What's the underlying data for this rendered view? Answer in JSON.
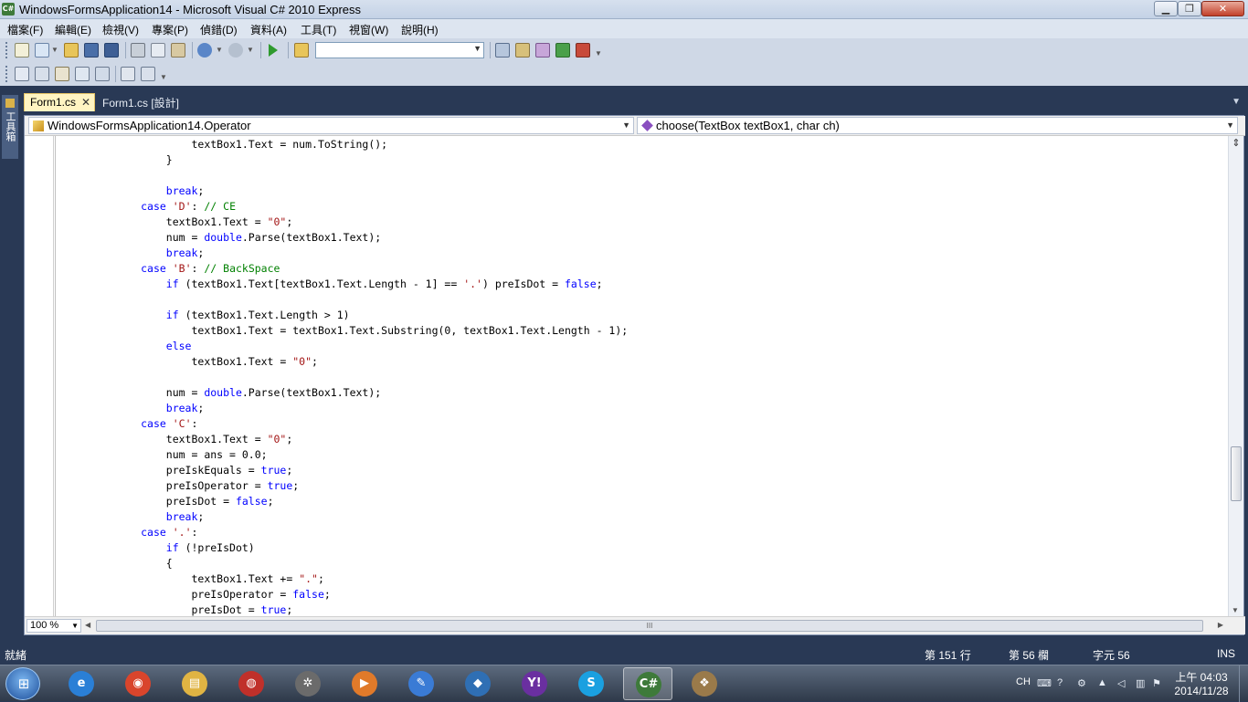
{
  "window": {
    "title": "WindowsFormsApplication14 - Microsoft Visual C# 2010 Express",
    "icon_label": "C#",
    "minimize_glyph": "▁",
    "maximize_glyph": "❐",
    "close_glyph": "✕"
  },
  "menu": [
    "檔案(F)",
    "編輯(E)",
    "檢視(V)",
    "專案(P)",
    "偵錯(D)",
    "資料(A)",
    "工具(T)",
    "視窗(W)",
    "說明(H)"
  ],
  "toolbar": {
    "solution_config_value": ""
  },
  "sidebar": {
    "toolbox_label": "工具箱"
  },
  "tabs": [
    {
      "label": "Form1.cs",
      "active": true,
      "close": "✕"
    },
    {
      "label": "Form1.cs [設計]",
      "active": false
    }
  ],
  "navbar": {
    "class_combo": "WindowsFormsApplication14.Operator",
    "member_combo": "choose(TextBox textBox1, char ch)"
  },
  "code": [
    [
      {
        "t": "                    textBox1.Text = num.ToString();"
      }
    ],
    [
      {
        "t": "                }"
      }
    ],
    [
      {
        "t": ""
      }
    ],
    [
      {
        "t": "                "
      },
      {
        "t": "break",
        "c": "kw"
      },
      {
        "t": ";"
      }
    ],
    [
      {
        "t": "            "
      },
      {
        "t": "case",
        "c": "kw"
      },
      {
        "t": " "
      },
      {
        "t": "'D'",
        "c": "str"
      },
      {
        "t": ": "
      },
      {
        "t": "// CE",
        "c": "cm"
      }
    ],
    [
      {
        "t": "                textBox1.Text = "
      },
      {
        "t": "\"0\"",
        "c": "str"
      },
      {
        "t": ";"
      }
    ],
    [
      {
        "t": "                num = "
      },
      {
        "t": "double",
        "c": "kw"
      },
      {
        "t": ".Parse(textBox1.Text);"
      }
    ],
    [
      {
        "t": "                "
      },
      {
        "t": "break",
        "c": "kw"
      },
      {
        "t": ";"
      }
    ],
    [
      {
        "t": "            "
      },
      {
        "t": "case",
        "c": "kw"
      },
      {
        "t": " "
      },
      {
        "t": "'B'",
        "c": "str"
      },
      {
        "t": ": "
      },
      {
        "t": "// BackSpace",
        "c": "cm"
      }
    ],
    [
      {
        "t": "                "
      },
      {
        "t": "if",
        "c": "kw"
      },
      {
        "t": " (textBox1.Text[textBox1.Text.Length - 1] == "
      },
      {
        "t": "'.'",
        "c": "str"
      },
      {
        "t": ") preIsDot = "
      },
      {
        "t": "false",
        "c": "kw"
      },
      {
        "t": ";"
      }
    ],
    [
      {
        "t": ""
      }
    ],
    [
      {
        "t": "                "
      },
      {
        "t": "if",
        "c": "kw"
      },
      {
        "t": " (textBox1.Text.Length > 1)"
      }
    ],
    [
      {
        "t": "                    textBox1.Text = textBox1.Text.Substring(0, textBox1.Text.Length - 1);"
      }
    ],
    [
      {
        "t": "                "
      },
      {
        "t": "else",
        "c": "kw"
      }
    ],
    [
      {
        "t": "                    textBox1.Text = "
      },
      {
        "t": "\"0\"",
        "c": "str"
      },
      {
        "t": ";"
      }
    ],
    [
      {
        "t": ""
      }
    ],
    [
      {
        "t": "                num = "
      },
      {
        "t": "double",
        "c": "kw"
      },
      {
        "t": ".Parse(textBox1.Text);"
      }
    ],
    [
      {
        "t": "                "
      },
      {
        "t": "break",
        "c": "kw"
      },
      {
        "t": ";"
      }
    ],
    [
      {
        "t": "            "
      },
      {
        "t": "case",
        "c": "kw"
      },
      {
        "t": " "
      },
      {
        "t": "'C'",
        "c": "str"
      },
      {
        "t": ":"
      }
    ],
    [
      {
        "t": "                textBox1.Text = "
      },
      {
        "t": "\"0\"",
        "c": "str"
      },
      {
        "t": ";"
      }
    ],
    [
      {
        "t": "                num = ans = 0.0;"
      }
    ],
    [
      {
        "t": "                preIskEquals = "
      },
      {
        "t": "true",
        "c": "kw"
      },
      {
        "t": ";"
      }
    ],
    [
      {
        "t": "                preIsOperator = "
      },
      {
        "t": "true",
        "c": "kw"
      },
      {
        "t": ";"
      }
    ],
    [
      {
        "t": "                preIsDot = "
      },
      {
        "t": "false",
        "c": "kw"
      },
      {
        "t": ";"
      }
    ],
    [
      {
        "t": "                "
      },
      {
        "t": "break",
        "c": "kw"
      },
      {
        "t": ";"
      }
    ],
    [
      {
        "t": "            "
      },
      {
        "t": "case",
        "c": "kw"
      },
      {
        "t": " "
      },
      {
        "t": "'.'",
        "c": "str"
      },
      {
        "t": ":"
      }
    ],
    [
      {
        "t": "                "
      },
      {
        "t": "if",
        "c": "kw"
      },
      {
        "t": " (!preIsDot)"
      }
    ],
    [
      {
        "t": "                {"
      }
    ],
    [
      {
        "t": "                    textBox1.Text += "
      },
      {
        "t": "\".\"",
        "c": "str"
      },
      {
        "t": ";"
      }
    ],
    [
      {
        "t": "                    preIsOperator = "
      },
      {
        "t": "false",
        "c": "kw"
      },
      {
        "t": ";"
      }
    ],
    [
      {
        "t": "                    preIsDot = "
      },
      {
        "t": "true",
        "c": "kw"
      },
      {
        "t": ";"
      }
    ]
  ],
  "editor": {
    "zoom": "100 %",
    "hscroll_grip": "III",
    "vscroll_split": "⇕"
  },
  "status": {
    "ready": "就緒",
    "line": "第 151 行",
    "column": "第 56 欄",
    "char": "字元 56",
    "mode": "INS"
  },
  "taskbar": {
    "apps": [
      {
        "name": "internet-explorer",
        "glyph": "e",
        "color": "#2a7fd6",
        "active": false
      },
      {
        "name": "chrome",
        "glyph": "◉",
        "color": "#d9452c",
        "active": false
      },
      {
        "name": "file-explorer",
        "glyph": "▤",
        "color": "#e0b443",
        "active": false
      },
      {
        "name": "app-red",
        "glyph": "◍",
        "color": "#c0302a",
        "active": false
      },
      {
        "name": "media-reel",
        "glyph": "✲",
        "color": "#6b6b6b",
        "active": false
      },
      {
        "name": "media-player",
        "glyph": "▶",
        "color": "#e07a2a",
        "active": false
      },
      {
        "name": "paint-tool",
        "glyph": "✎",
        "color": "#3a7bd5",
        "active": false
      },
      {
        "name": "shield-app",
        "glyph": "◆",
        "color": "#2f6fb4",
        "active": false
      },
      {
        "name": "yahoo-messenger",
        "glyph": "Y!",
        "color": "#6a2fa0",
        "active": false
      },
      {
        "name": "skype",
        "glyph": "S",
        "color": "#1aa0e0",
        "active": false
      },
      {
        "name": "visual-csharp",
        "glyph": "C#",
        "color": "#3e7a3a",
        "active": true
      },
      {
        "name": "paint-palette",
        "glyph": "❖",
        "color": "#9a7a4a",
        "active": false
      }
    ],
    "language": "CH",
    "clock_time": "上午 04:03",
    "clock_date": "2014/11/28"
  }
}
